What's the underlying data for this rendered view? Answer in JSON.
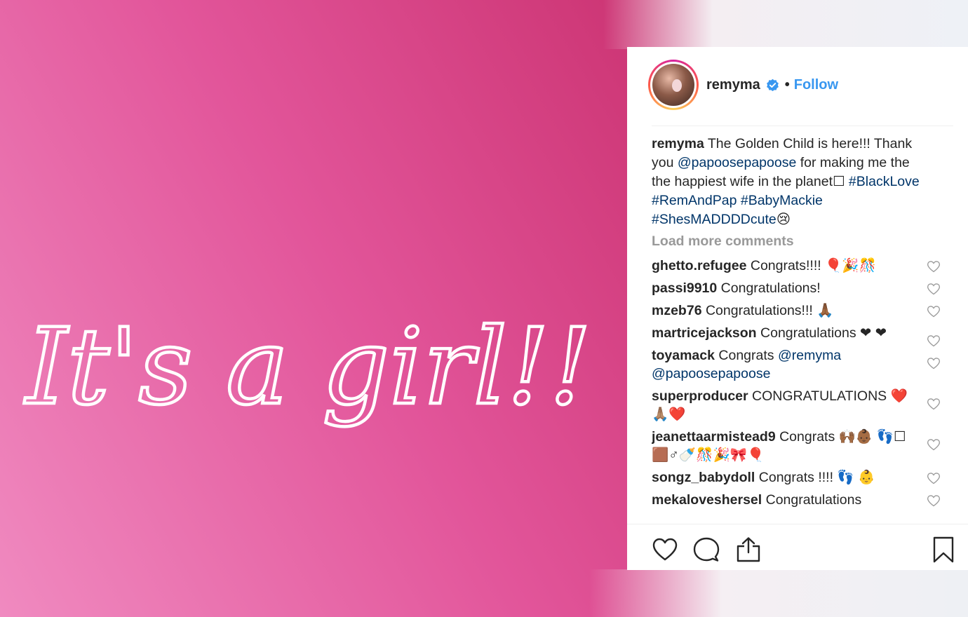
{
  "image": {
    "script_text": "It's a girl!!"
  },
  "post": {
    "username": "remyma",
    "separator": "•",
    "follow_label": "Follow"
  },
  "caption": {
    "username": "remyma",
    "text_1": " The Golden Child is here!!! Thank you ",
    "mention_1": "@papoosepapoose",
    "text_2": " for making me the the happiest wife in the planet☐ ",
    "tag_1": "#BlackLove",
    "tag_2": "#RemAndPap",
    "tag_3": "#BabyMackie",
    "tag_4": "#ShesMADDDDcute",
    "emoji": "😢"
  },
  "load_more_label": "Load more comments",
  "comments": [
    {
      "user": "ghetto.refugee",
      "text": " Congrats!!!! 🎈🎉🎊"
    },
    {
      "user": "passi9910",
      "text": " Congratulations!"
    },
    {
      "user": "mzeb76",
      "text": " Congratulations!!! 🙏🏾"
    },
    {
      "user": "martricejackson",
      "text": " Congratulations ❤ ❤"
    },
    {
      "user": "toyamack",
      "text": " Congrats ",
      "mention_1": "@remyma",
      "mention_2": "@papoosepapoose"
    },
    {
      "user": "superproducer",
      "text": " CONGRATULATIONS ❤️🙏🏽❤️"
    },
    {
      "user": "jeanettaarmistead9",
      "text": " Congrats 🙌🏾👶🏾 👣☐🟫♂🍼🎊🎉🎀🎈"
    },
    {
      "user": "songz_babydoll",
      "text": " Congrats !!!! 👣 👶"
    },
    {
      "user": "mekaloveshersel",
      "text": " Congratulations"
    }
  ],
  "icons": {
    "verified": "verified-badge-icon",
    "like": "heart-icon",
    "comment": "comment-bubble-icon",
    "share": "share-icon",
    "save": "bookmark-icon"
  },
  "colors": {
    "link_blue": "#3897f0",
    "hashtag": "#003569",
    "muted": "#999999",
    "text": "#262626"
  }
}
